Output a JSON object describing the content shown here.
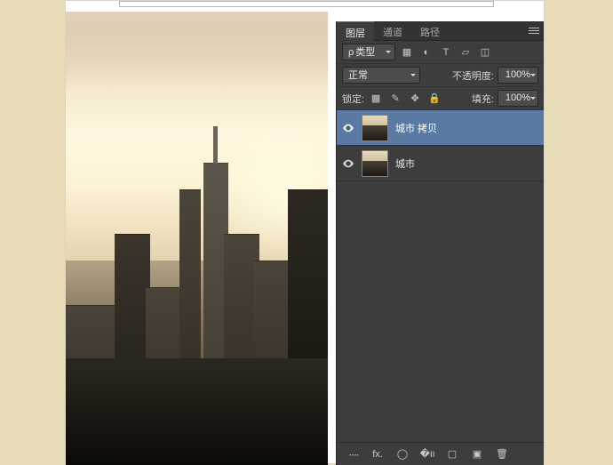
{
  "tabs": {
    "layers": "图层",
    "channels": "通道",
    "paths": "路径"
  },
  "filter": {
    "kind": "类型"
  },
  "blend": {
    "mode": "正常",
    "opacity_label": "不透明度:",
    "opacity": "100%"
  },
  "lock": {
    "label": "锁定:",
    "fill_label": "填充:",
    "fill": "100%"
  },
  "layer_list": [
    {
      "name": "城市 拷贝",
      "visible": true,
      "selected": true
    },
    {
      "name": "城市",
      "visible": true,
      "selected": false
    }
  ],
  "icons": {
    "search": "🔍",
    "image": "▦",
    "adjust": "◐",
    "type": "T",
    "shape": "▱",
    "smart": "◫",
    "pixels": "▩",
    "brush": "✎",
    "move": "✥",
    "lock": "🔒",
    "link": "᠁",
    "fx": "fx.",
    "mask": "◯",
    "fill": "�װ",
    "group": "▢",
    "new": "▣",
    "trash": "🗑"
  }
}
